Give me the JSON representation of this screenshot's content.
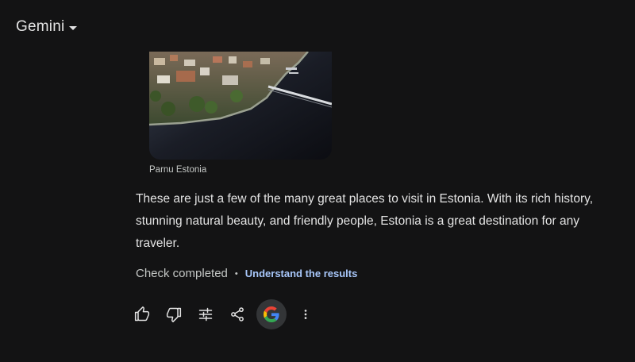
{
  "header": {
    "model_name": "Gemini",
    "dropdown_icon": "caret-down-icon"
  },
  "image": {
    "subject": "aerial view of a coastal town with a bridge over dark water",
    "caption": "Parnu Estonia"
  },
  "response": {
    "text": "These are just a few of the many great places to visit in Estonia. With its rich history, stunning natural beauty, and friendly people, Estonia is a great destination for any traveler."
  },
  "double_check": {
    "status": "Check completed",
    "separator": "•",
    "link_label": "Understand the results",
    "link_color": "#a8c7fa"
  },
  "actions": [
    {
      "name": "thumbs-up-icon",
      "label": "Good response"
    },
    {
      "name": "thumbs-down-icon",
      "label": "Bad response"
    },
    {
      "name": "tune-icon",
      "label": "Modify response"
    },
    {
      "name": "share-icon",
      "label": "Share"
    },
    {
      "name": "google-icon",
      "label": "Double-check response"
    },
    {
      "name": "more-vert-icon",
      "label": "More"
    }
  ],
  "colors": {
    "background": "#131314",
    "text": "#e3e3e3",
    "muted_text": "#c4c7c5",
    "google_button_bg": "#333537"
  }
}
